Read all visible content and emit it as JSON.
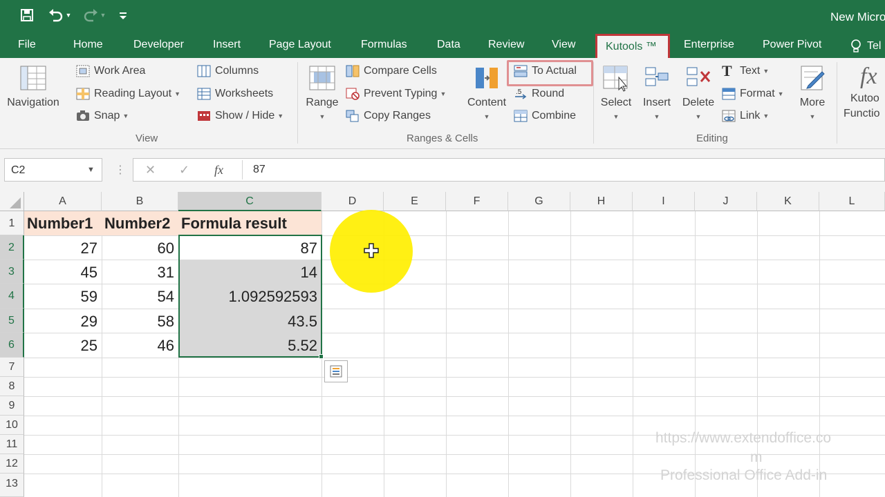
{
  "window": {
    "title": "New Micro"
  },
  "tabs": [
    "File",
    "Home",
    "Developer",
    "Insert",
    "Page Layout",
    "Formulas",
    "Data",
    "Review",
    "View",
    "Kutools ™",
    "Enterprise",
    "Power Pivot",
    "Tel"
  ],
  "active_tab": "Kutools ™",
  "ribbon": {
    "view_group": {
      "navigation": "Navigation",
      "work_area": "Work Area",
      "reading_layout": "Reading Layout",
      "snap": "Snap",
      "columns": "Columns",
      "worksheets": "Worksheets",
      "show_hide": "Show / Hide",
      "label": "View"
    },
    "ranges_group": {
      "range": "Range",
      "compare_cells": "Compare Cells",
      "prevent_typing": "Prevent Typing",
      "copy_ranges": "Copy Ranges",
      "content": "Content",
      "to_actual": "To Actual",
      "round": "Round",
      "combine": "Combine",
      "label": "Ranges & Cells"
    },
    "editing_group": {
      "select": "Select",
      "insert": "Insert",
      "delete": "Delete",
      "text": "Text",
      "format": "Format",
      "link": "Link",
      "more": "More",
      "label": "Editing"
    },
    "functions": {
      "line1": "Kutoo",
      "line2": "Functio"
    }
  },
  "formula_bar": {
    "name_box": "C2",
    "value": "87",
    "fx": "fx"
  },
  "columns": [
    "A",
    "B",
    "C",
    "D",
    "E",
    "F",
    "G",
    "H",
    "I",
    "J",
    "K",
    "L"
  ],
  "rows": [
    "1",
    "2",
    "3",
    "4",
    "5",
    "6",
    "7",
    "8",
    "9",
    "10",
    "11",
    "12",
    "13"
  ],
  "table": {
    "headers": [
      "Number1",
      "Number2",
      "Formula result"
    ],
    "rows": [
      [
        "27",
        "60",
        "87"
      ],
      [
        "45",
        "31",
        "14"
      ],
      [
        "59",
        "54",
        "1.092592593"
      ],
      [
        "29",
        "58",
        "43.5"
      ],
      [
        "25",
        "46",
        "5.52"
      ]
    ]
  },
  "watermark": {
    "line1": "https://www.extendoffice.co",
    "line2": "m",
    "line3": "Professional Office Add-in"
  },
  "colors": {
    "excel_green": "#217346",
    "header_fill": "#fce4d6",
    "highlight_red": "#c0373a",
    "spotlight": "#ffef00"
  }
}
